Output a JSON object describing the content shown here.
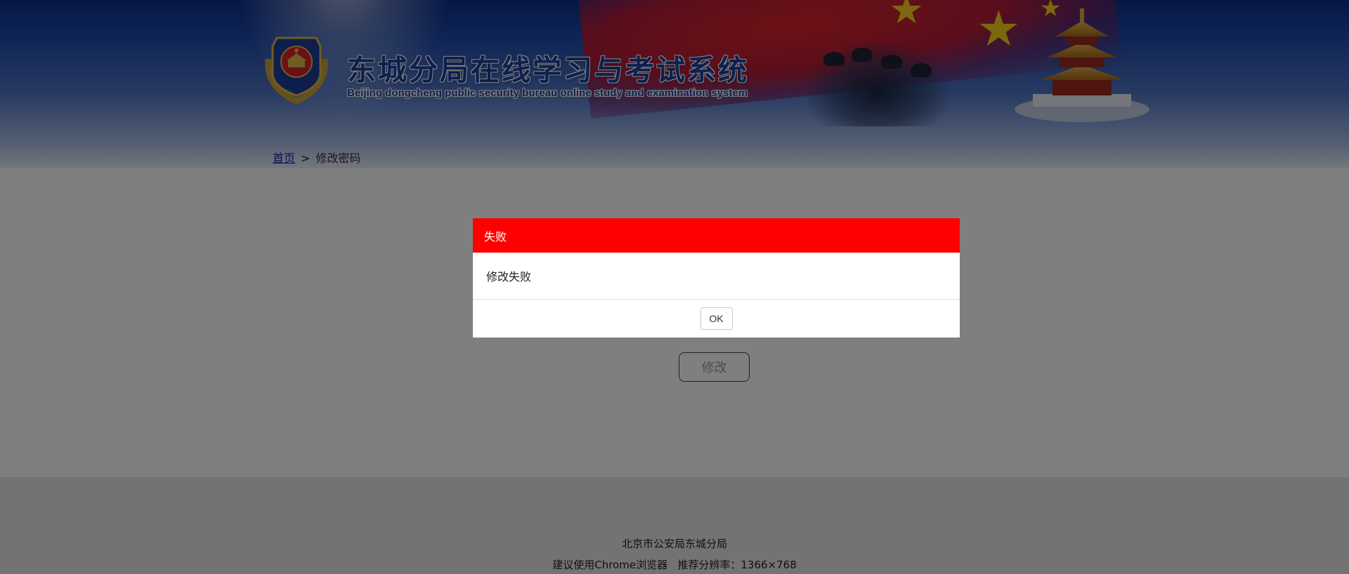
{
  "header": {
    "title_cn": "东城分局在线学习与考试系统",
    "title_en": "Beijing dongcheng public security bureau online study and examination system",
    "emblem_icon": "police-emblem-icon",
    "brand_color": "#1a3e9e"
  },
  "breadcrumb": {
    "home": "首页",
    "separator": ">",
    "current": "修改密码"
  },
  "form": {
    "submit_label": "修改"
  },
  "footer": {
    "org": "北京市公安局东城分局",
    "recommend": "建议使用Chrome浏览器   推荐分辨率：1366×768"
  },
  "dialog": {
    "title": "失败",
    "message": "修改失败",
    "ok_label": "OK",
    "header_color": "#ff0000"
  }
}
